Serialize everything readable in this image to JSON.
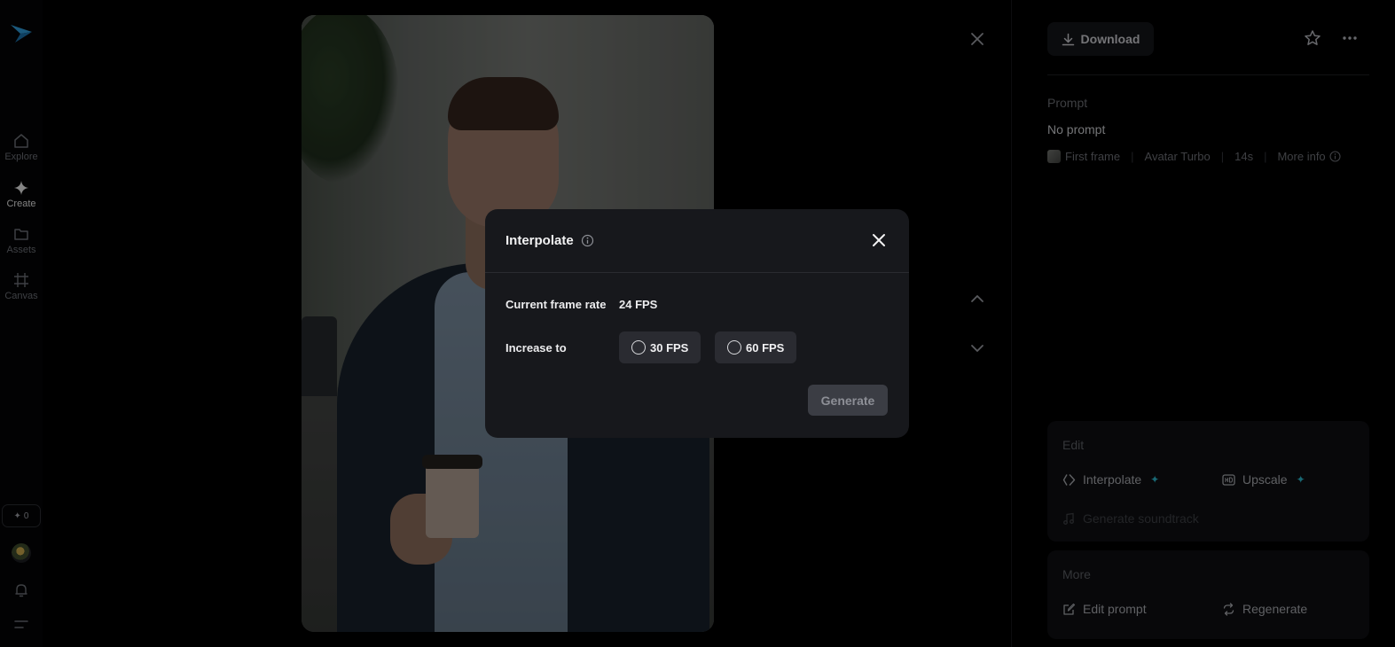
{
  "sidebar": {
    "items": [
      {
        "label": "Explore",
        "icon": "home-icon"
      },
      {
        "label": "Create",
        "icon": "diamond-icon"
      },
      {
        "label": "Assets",
        "icon": "folder-icon"
      },
      {
        "label": "Canvas",
        "icon": "frame-icon"
      }
    ],
    "credits": "0",
    "credits_icon": "sparkle-icon"
  },
  "toolbar": {
    "download_label": "Download"
  },
  "details": {
    "prompt_label": "Prompt",
    "prompt_text": "No prompt",
    "meta": {
      "first_frame": "First frame",
      "model": "Avatar Turbo",
      "duration": "14s",
      "more_info": "More info"
    }
  },
  "edit_card": {
    "title": "Edit",
    "interpolate_label": "Interpolate",
    "upscale_label": "Upscale",
    "soundtrack_label": "Generate soundtrack"
  },
  "more_card": {
    "title": "More",
    "edit_prompt_label": "Edit prompt",
    "regenerate_label": "Regenerate"
  },
  "modal": {
    "title": "Interpolate",
    "current_label": "Current frame rate",
    "current_value": "24 FPS",
    "increase_label": "Increase to",
    "options": [
      "30 FPS",
      "60 FPS"
    ],
    "generate_label": "Generate"
  },
  "colors": {
    "accent": "#2bb3c9",
    "modal_bg": "#17181c",
    "option_bg": "#2a2b31"
  }
}
